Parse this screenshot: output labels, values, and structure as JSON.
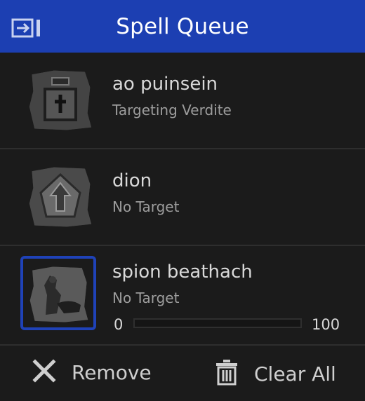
{
  "header": {
    "title": "Spell Queue",
    "collapse_icon": "collapse-panel-icon"
  },
  "queue": [
    {
      "name": "ao puinsein",
      "target": "Targeting Verdite",
      "icon": "poison-bottle-icon"
    },
    {
      "name": "dion",
      "target": "No Target",
      "icon": "shield-arrow-icon"
    },
    {
      "name": "spion beathach",
      "target": "No Target",
      "icon": "creature-spell-icon",
      "selected": true,
      "progress": {
        "min": "0",
        "max": "100",
        "value": 0
      }
    }
  ],
  "footer": {
    "remove_label": "Remove",
    "remove_icon": "close-icon",
    "clear_label": "Clear All",
    "clear_icon": "trash-icon"
  },
  "colors": {
    "header": "#1c3fb2",
    "background": "#1b1b1b",
    "selection": "#1f42b8"
  }
}
